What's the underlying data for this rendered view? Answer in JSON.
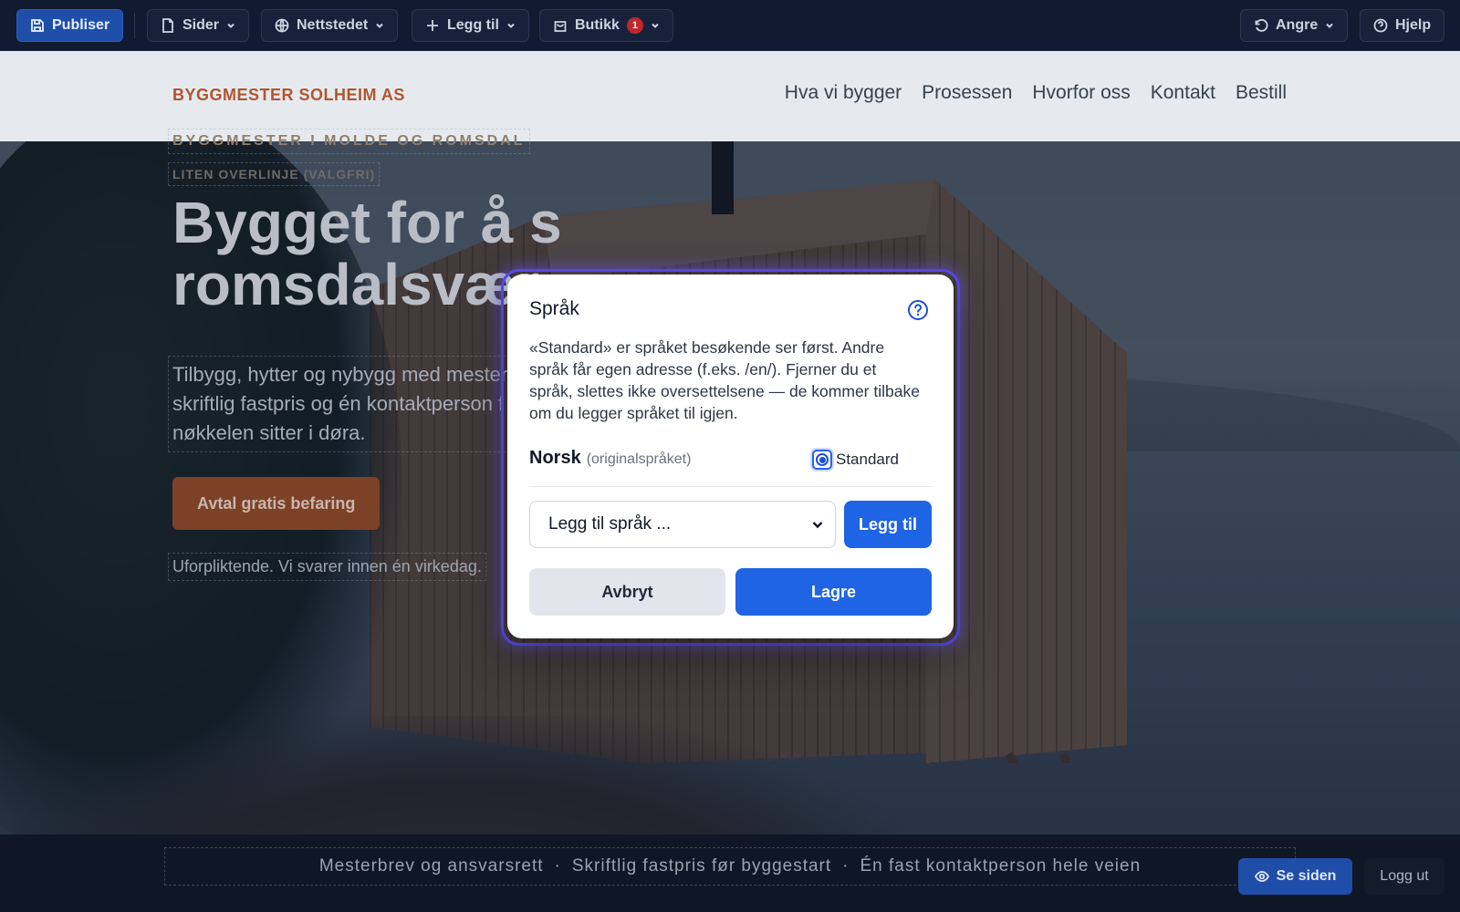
{
  "toolbar": {
    "publish_label": "Publiser",
    "pages_label": "Sider",
    "website_label": "Nettstedet",
    "add_label": "Legg til",
    "shop_label": "Butikk",
    "shop_badge": "1",
    "undo_label": "Angre",
    "help_label": "Hjelp",
    "icons": [
      "save-icon",
      "page-icon",
      "globe-icon",
      "plus-icon",
      "shopping-bag-icon",
      "undo-icon",
      "help-icon",
      "chevron-down-icon"
    ]
  },
  "site": {
    "logo": "BYGGMESTER SOLHEIM AS",
    "nav": [
      "Hva vi bygger",
      "Prosessen",
      "Hvorfor oss",
      "Kontakt",
      "Bestill"
    ],
    "eyebrow": "BYGGMESTER I MOLDE OG ROMSDAL",
    "overline": "LITEN OVERLINJE (VALGFRI)",
    "title_line1": "Bygget for å s",
    "title_line2": "romsdalsvær",
    "lead": "Tilbygg, hytter og nybygg med mester skriftlig fastpris og én kontaktperson f nøkkelen sitter i døra.",
    "cta": "Avtal gratis befaring",
    "cta_note": "Uforpliktende. Vi svarer innen én virkedag.",
    "trust": [
      "Mesterbrev og ansvarsrett",
      "Skriftlig fastpris før byggestart",
      "Én fast kontaktperson hele veien"
    ],
    "trust_separator": "·",
    "accent_color": "#b0562d"
  },
  "modal": {
    "title": "Språk",
    "description": "«Standard» er språket besøkende ser først. Andre språk får egen adresse (f.eks. /en/). Fjerner du et språk, slettes ikke oversettelsene — de kommer tilbake om du legger språket til igjen.",
    "language_name": "Norsk",
    "language_note": "(originalspråket)",
    "default_label": "Standard",
    "default_selected": true,
    "add_language_placeholder": "Legg til språk ...",
    "add_button": "Legg til",
    "cancel_button": "Avbryt",
    "save_button": "Lagre",
    "primary_color": "#1f64e4"
  },
  "bottom_bar": {
    "view_site_label": "Se siden",
    "logout_label": "Logg ut"
  }
}
